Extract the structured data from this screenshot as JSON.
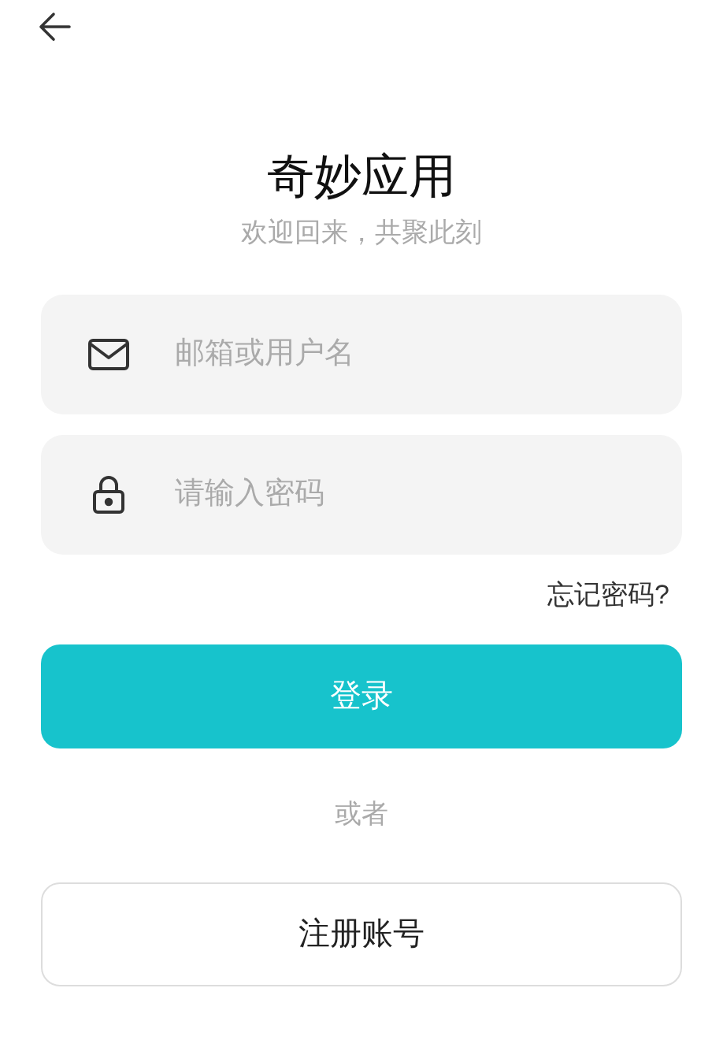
{
  "title": "奇妙应用",
  "subtitle": "欢迎回来，共聚此刻",
  "fields": [
    {
      "kind": "email",
      "placeholder": "邮箱或用户名"
    },
    {
      "kind": "password",
      "placeholder": "请输入密码"
    }
  ],
  "forgot_link": "忘记密码?",
  "login_button": "登录",
  "divider_text": "或者",
  "register_button": "注册账号"
}
